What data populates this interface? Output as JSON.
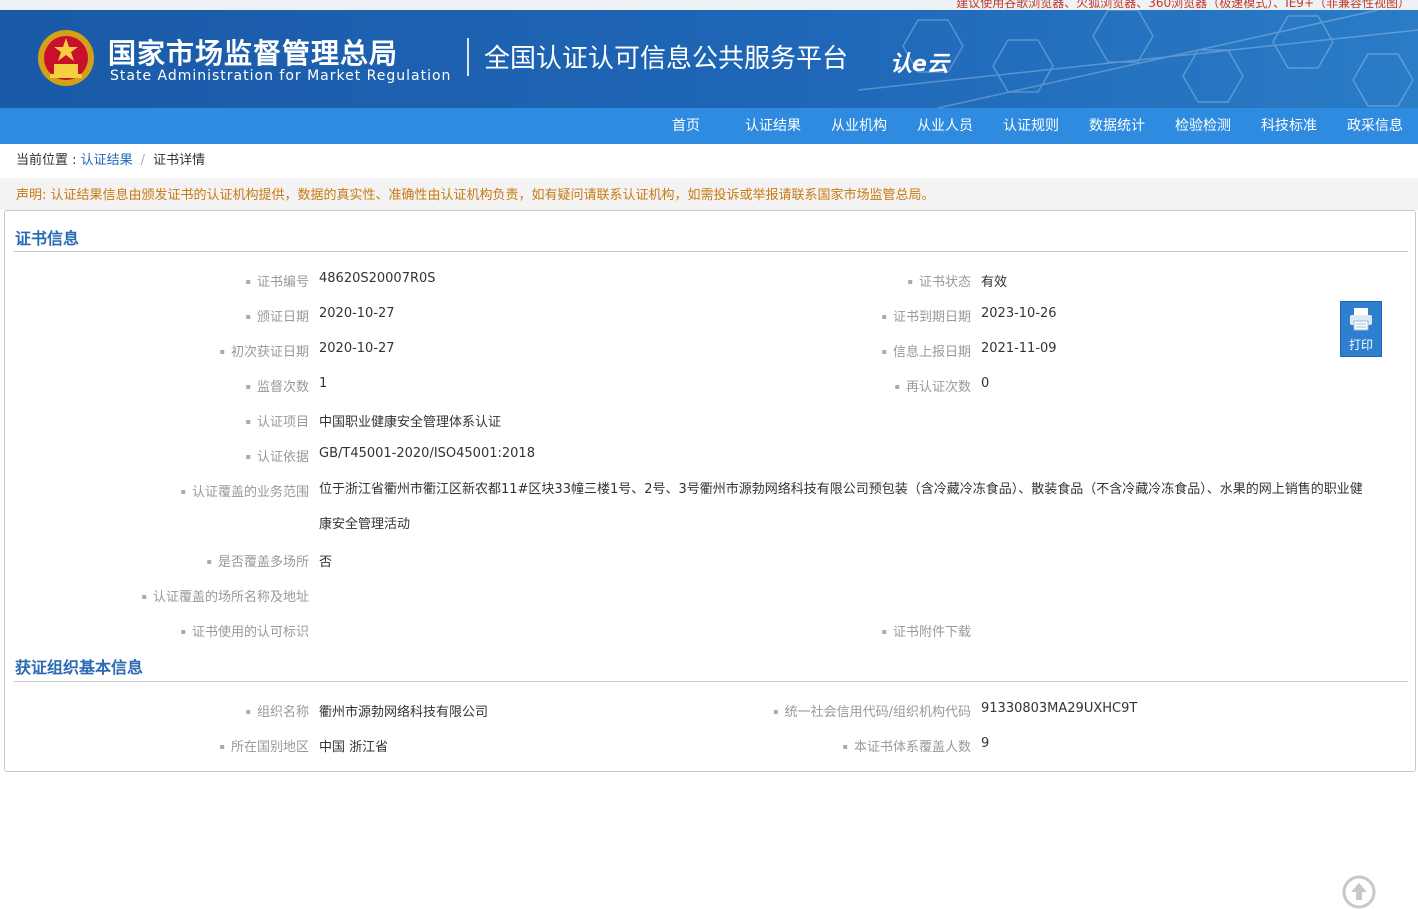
{
  "browser_notice": "建议使用谷歌浏览器、火狐浏览器、360浏览器（极速模式）、IE9+（非兼容性视图）",
  "header": {
    "org_cn": "国家市场监督管理总局",
    "org_en": "State Administration  for  Market Regulation",
    "platform": "全国认证认可信息公共服务平台",
    "logo_text": "认e云"
  },
  "nav": {
    "items": [
      {
        "label": "首页"
      },
      {
        "label": "认证结果"
      },
      {
        "label": "从业机构"
      },
      {
        "label": "从业人员"
      },
      {
        "label": "认证规则"
      },
      {
        "label": "数据统计"
      },
      {
        "label": "检验检测"
      },
      {
        "label": "科技标准"
      },
      {
        "label": "政采信息"
      }
    ]
  },
  "breadcrumb": {
    "prefix": "当前位置 : ",
    "parent": "认证结果",
    "sep": "/",
    "current": "证书详情"
  },
  "disclaimer": "声明: 认证结果信息由颁发证书的认证机构提供，数据的真实性、准确性由认证机构负责，如有疑问请联系认证机构，如需投诉或举报请联系国家市场监管总局。",
  "cert_section": {
    "title": "证书信息",
    "fields": {
      "cert_no": {
        "label": "证书编号",
        "value": "48620S20007R0S"
      },
      "status": {
        "label": "证书状态",
        "value": "有效"
      },
      "issue_date": {
        "label": "颁证日期",
        "value": "2020-10-27"
      },
      "expire_date": {
        "label": "证书到期日期",
        "value": "2023-10-26"
      },
      "first_date": {
        "label": "初次获证日期",
        "value": "2020-10-27"
      },
      "report_date": {
        "label": "信息上报日期",
        "value": "2021-11-09"
      },
      "supervision": {
        "label": "监督次数",
        "value": "1"
      },
      "recert": {
        "label": "再认证次数",
        "value": "0"
      },
      "project": {
        "label": "认证项目",
        "value": "中国职业健康安全管理体系认证"
      },
      "basis": {
        "label": "认证依据",
        "value": "GB/T45001-2020/ISO45001:2018"
      },
      "scope": {
        "label": "认证覆盖的业务范围",
        "value": "位于浙江省衢州市衢江区新农都11#区块33幢三楼1号、2号、3号衢州市源勃网络科技有限公司预包装（含冷藏冷冻食品）、散装食品（不含冷藏冷冻食品）、水果的网上销售的职业健康安全管理活动"
      },
      "multi_site": {
        "label": "是否覆盖多场所",
        "value": "否"
      },
      "sites": {
        "label": "认证覆盖的场所名称及地址",
        "value": ""
      },
      "mark": {
        "label": "证书使用的认可标识",
        "value": ""
      },
      "attachment": {
        "label": "证书附件下载",
        "value": ""
      }
    },
    "print_label": "打印"
  },
  "org_section": {
    "title": "获证组织基本信息",
    "fields": {
      "org_name": {
        "label": "组织名称",
        "value": "衢州市源勃网络科技有限公司"
      },
      "credit_code": {
        "label": "统一社会信用代码/组织机构代码",
        "value": "91330803MA29UXHC9T"
      },
      "region": {
        "label": "所在国别地区",
        "value": "中国 浙江省"
      },
      "headcount": {
        "label": "本证书体系覆盖人数",
        "value": "9"
      }
    }
  },
  "colors": {
    "banner": "#1f66b6",
    "nav": "#2e8be0",
    "section_title": "#2a6bb2",
    "disclaimer": "#c97a14",
    "notice": "#c0392b"
  }
}
